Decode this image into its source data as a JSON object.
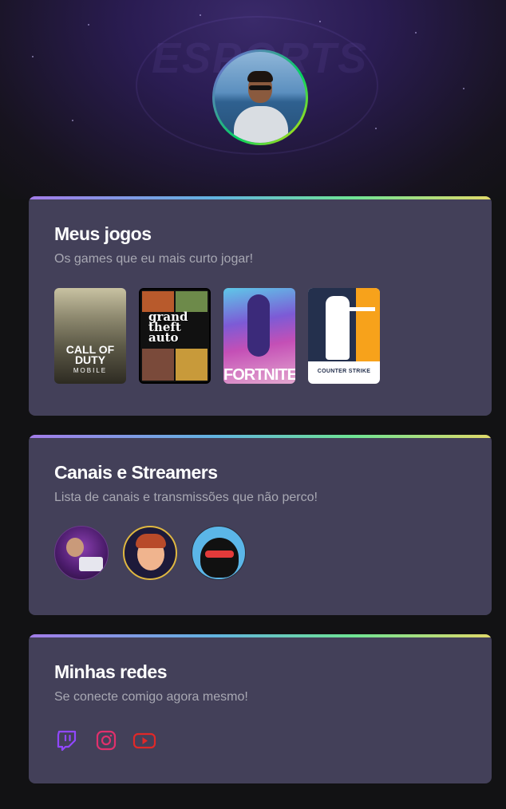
{
  "hero": {
    "background_logo_text": "ESPORTS",
    "avatar_alt": "Profile avatar"
  },
  "games_card": {
    "title": "Meus jogos",
    "subtitle": "Os games que eu mais curto jogar!",
    "games": [
      {
        "name": "Call of Duty Mobile",
        "label": "CALL OF DUTY",
        "sublabel": "MOBILE"
      },
      {
        "name": "Grand Theft Auto V",
        "label": "grand theft auto"
      },
      {
        "name": "Fortnite",
        "label": "FORTNITE"
      },
      {
        "name": "Counter-Strike",
        "label": "COUNTER STRIKE"
      }
    ]
  },
  "streamers_card": {
    "title": "Canais e Streamers",
    "subtitle": "Lista de canais e transmissões que não perco!",
    "streamers": [
      {
        "name": "streamer-1"
      },
      {
        "name": "streamer-2"
      },
      {
        "name": "streamer-3"
      }
    ]
  },
  "social_card": {
    "title": "Minhas redes",
    "subtitle": "Se conecte comigo agora mesmo!",
    "links": [
      {
        "icon": "twitch-icon",
        "color": "#9147ff"
      },
      {
        "icon": "instagram-icon",
        "color": "#e1306c"
      },
      {
        "icon": "youtube-icon",
        "color": "#e02828"
      }
    ]
  },
  "colors": {
    "page_bg": "#121214",
    "card_bg": "#434059",
    "title": "#ffffff",
    "subtitle": "#a8a8b3",
    "gradient_start": "#a37ce9",
    "gradient_end": "#e1d96a"
  }
}
